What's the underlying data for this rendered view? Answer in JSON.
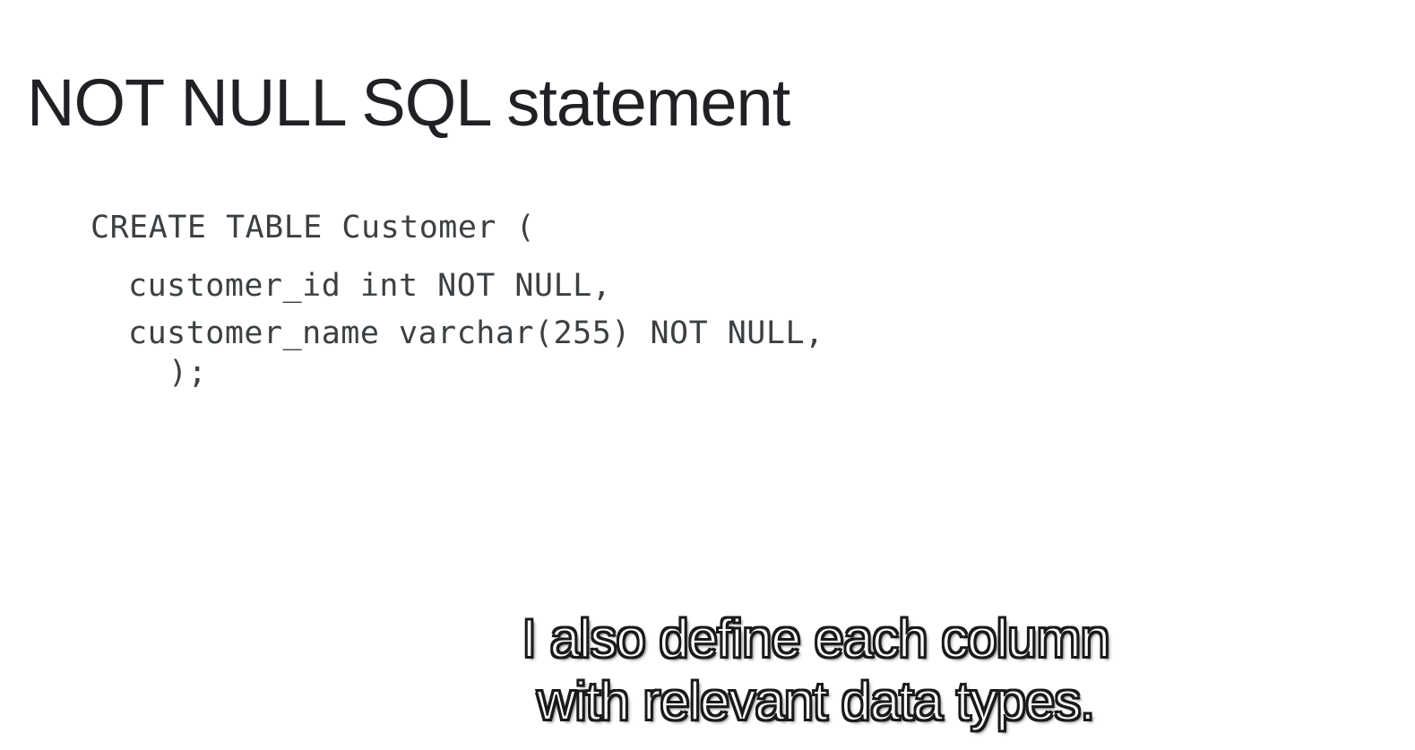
{
  "slide": {
    "title": "NOT NULL SQL statement",
    "code": {
      "line1": "CREATE TABLE Customer (",
      "line2": "customer_id int NOT NULL,",
      "line3": "customer_name varchar(255) NOT NULL,",
      "line4": ");"
    }
  },
  "subtitle": {
    "line1": "I also define each column",
    "line2": "with relevant data types."
  }
}
